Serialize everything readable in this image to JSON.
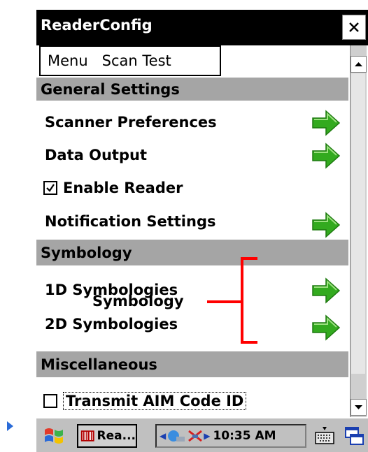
{
  "window": {
    "title": "ReaderConfig",
    "close_glyph": "✕"
  },
  "menu": {
    "items": [
      "Menu",
      "Scan Test"
    ]
  },
  "sections": [
    {
      "header": "General Settings",
      "rows": [
        {
          "label": "Scanner Preferences",
          "type": "link"
        },
        {
          "label": "Data Output",
          "type": "link"
        },
        {
          "label": "Enable Reader",
          "type": "checkbox",
          "checked": true
        },
        {
          "label": "Notification Settings",
          "type": "link"
        }
      ]
    },
    {
      "header": "Symbology",
      "rows": [
        {
          "label": "1D Symbologies",
          "type": "link"
        },
        {
          "label": "2D Symbologies",
          "type": "link"
        }
      ]
    },
    {
      "header": "Miscellaneous",
      "rows": [
        {
          "label": "Transmit AIM Code ID",
          "type": "checkbox",
          "checked": false
        }
      ]
    }
  ],
  "annotation": {
    "label": "Symbology",
    "color": "#ff0000"
  },
  "taskbar": {
    "app_label": "Rea...",
    "clock": "10:35 AM"
  },
  "colors": {
    "title_bg": "#000000",
    "section_header_bg": "#a5a5a5",
    "arrow_green": "#33aa1f"
  }
}
